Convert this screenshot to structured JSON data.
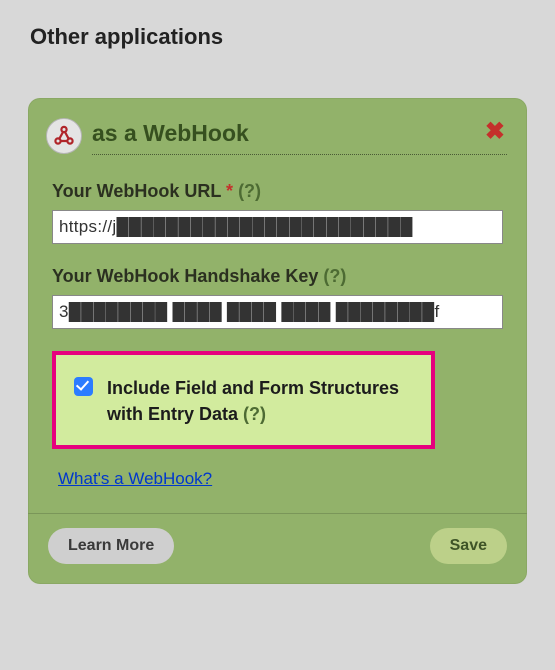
{
  "heading": "Other applications",
  "card": {
    "title": "as a WebHook",
    "url": {
      "label": "Your WebHook URL",
      "required": "*",
      "help": "(?)",
      "value": "https://j████████████████████████"
    },
    "key": {
      "label": "Your WebHook Handshake Key",
      "help": "(?)",
      "value": "3████████ ████ ████ ████ ████████f"
    },
    "include": {
      "label": "Include Field and Form Structures with Entry Data",
      "help": "(?)"
    },
    "link": "What's a WebHook?",
    "footer": {
      "learn": "Learn More",
      "save": "Save"
    }
  }
}
